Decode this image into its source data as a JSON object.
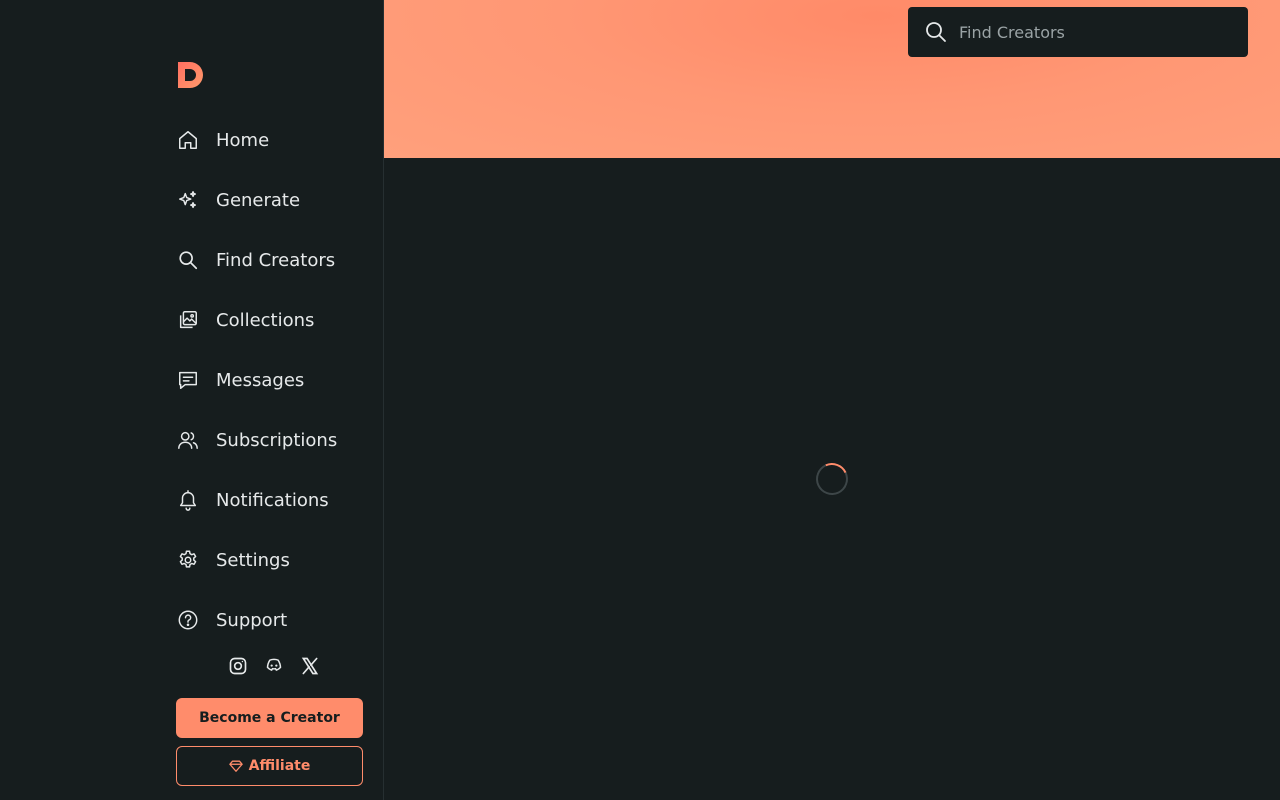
{
  "search": {
    "placeholder": "Find Creators"
  },
  "nav": {
    "items": [
      {
        "label": "Home",
        "icon": "home-icon"
      },
      {
        "label": "Generate",
        "icon": "sparkles-icon"
      },
      {
        "label": "Find Creators",
        "icon": "search-icon"
      },
      {
        "label": "Collections",
        "icon": "collections-icon"
      },
      {
        "label": "Messages",
        "icon": "message-icon"
      },
      {
        "label": "Subscriptions",
        "icon": "users-icon"
      },
      {
        "label": "Notifications",
        "icon": "bell-icon"
      },
      {
        "label": "Settings",
        "icon": "gear-icon"
      },
      {
        "label": "Support",
        "icon": "help-icon"
      }
    ]
  },
  "socials": [
    "instagram-icon",
    "discord-icon",
    "x-icon"
  ],
  "buttons": {
    "become_creator": "Become a Creator",
    "affiliate": "Affiliate"
  },
  "colors": {
    "accent": "#ff8c6b",
    "background": "#161d1e"
  }
}
